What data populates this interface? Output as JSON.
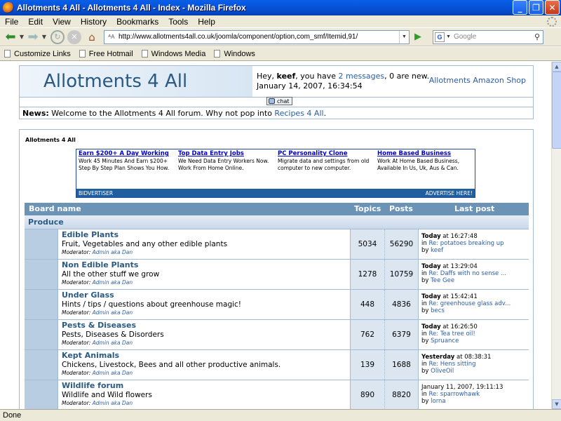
{
  "window": {
    "title": "Allotments 4 All - Allotments 4 All - Index - Mozilla Firefox"
  },
  "menu": [
    "File",
    "Edit",
    "View",
    "History",
    "Bookmarks",
    "Tools",
    "Help"
  ],
  "nav": {
    "url": "http://www.allotments4all.co.uk/joomla/component/option,com_smf/Itemid,91/",
    "search_placeholder": "Google"
  },
  "bookmarks": [
    "Customize Links",
    "Free Hotmail",
    "Windows Media",
    "Windows"
  ],
  "status": "Done",
  "header": {
    "logo": "Allotments 4 All",
    "greet_pre": "Hey,",
    "username": "keef",
    "greet_mid": ", you have",
    "messages": "2 messages",
    "greet_post": ", 0 are new.",
    "datetime": "January 14, 2007, 16:34:54",
    "shop_link": "Allotments Amazon Shop",
    "chat": "chat"
  },
  "news": {
    "label": "News:",
    "text": "Welcome to the Allotments 4 All forum. Why not pop into",
    "link": "Recipes 4 All",
    "end": "."
  },
  "breadcrumb": "Allotments 4 All",
  "ad": {
    "items": [
      {
        "title": "Earn $200+ A Day Working",
        "body": "Work 45 Minutes And Earn $200+ Step By Step Plan Shows You How."
      },
      {
        "title": "Top Data Entry Jobs",
        "body": "We Need Data Entry Workers Now. Work From Home Online."
      },
      {
        "title": "PC Personality Clone",
        "body": "Migrate data and settings from old computer to new computer."
      },
      {
        "title": "Home Based Business",
        "body": "Work At Home Based Business, Available In Us, Uk, Aus & Can."
      }
    ],
    "left": "BIDVERTISER",
    "right": "ADVERTISE HERE!"
  },
  "table": {
    "headers": {
      "board": "Board name",
      "topics": "Topics",
      "posts": "Posts",
      "last": "Last post"
    },
    "category": "Produce",
    "moderator_label": "Moderator:",
    "boards": [
      {
        "name": "Edible Plants",
        "desc": "Fruit, Vegetables and any other edible plants",
        "mod": "Admin aka Dan",
        "topics": "5034",
        "posts": "56290",
        "day": "Today",
        "time": " at 16:27:48",
        "in": "in",
        "topic": "Re: potatoes breaking up",
        "by": "by",
        "user": "keef"
      },
      {
        "name": "Non Edible Plants",
        "desc": "All the other stuff we grow",
        "mod": "Admin aka Dan",
        "topics": "1278",
        "posts": "10759",
        "day": "Today",
        "time": " at 13:29:04",
        "in": "in",
        "topic": "Re: Daffs with no sense ...",
        "by": "by",
        "user": "Tee Gee"
      },
      {
        "name": "Under Glass",
        "desc": "Hints / tips / questions about greenhouse magic!",
        "mod": "Admin aka Dan",
        "topics": "448",
        "posts": "4836",
        "day": "Today",
        "time": " at 15:42:41",
        "in": "in",
        "topic": "Re: greenhouse glass adv...",
        "by": "by",
        "user": "becs"
      },
      {
        "name": "Pests & Diseases",
        "desc": "Pests, Diseases & Disorders",
        "mod": "Admin aka Dan",
        "topics": "762",
        "posts": "6379",
        "day": "Today",
        "time": " at 16:26:50",
        "in": "in",
        "topic": "Re: Tea tree oil!",
        "by": "by",
        "user": "Spruance"
      },
      {
        "name": "Kept Animals",
        "desc": "Chickens, Livestock, Bees and all other productive animals.",
        "mod": "Admin aka Dan",
        "topics": "139",
        "posts": "1688",
        "day": "Yesterday",
        "time": " at 08:38:31",
        "in": "in",
        "topic": "Re: Hens sitting",
        "by": "by",
        "user": "OliveOil"
      },
      {
        "name": "Wildlife forum",
        "desc": "Wildlife and Wild flowers",
        "mod": "Admin aka Dan",
        "topics": "890",
        "posts": "8820",
        "day": "",
        "time": "January 11, 2007, 19:11:13",
        "in": "in",
        "topic": "Re: sparrowhawk",
        "by": "by",
        "user": "lorna"
      }
    ]
  }
}
